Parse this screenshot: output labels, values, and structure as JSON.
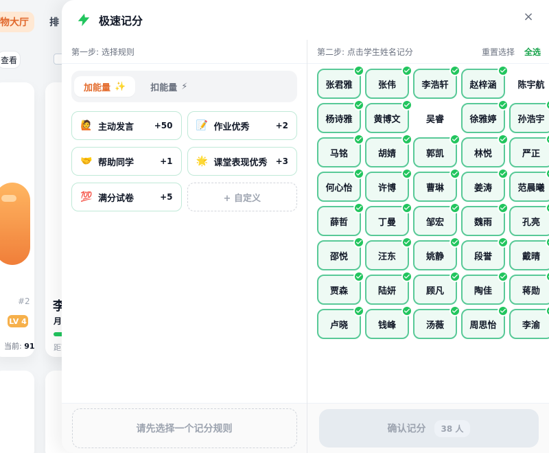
{
  "background": {
    "top_tab_1": "物大厅",
    "top_tab_2": "排",
    "view_button": "查看",
    "rank_label": "#2",
    "level_badge": "LV 4",
    "current_label": "当前:",
    "current_value": "91",
    "student_name_partial": "李",
    "month_label_partial": "月",
    "distance_label_partial": "距下"
  },
  "modal": {
    "title": "极速记分",
    "close_symbol": "×",
    "step1_label": "第一步: 选择规则",
    "step2_label": "第二步: 点击学生姓名记分",
    "reset_label": "重置选择",
    "select_all_label": "全选",
    "tabs": [
      {
        "label": "加能量",
        "icon": "sparkles"
      },
      {
        "label": "扣能量",
        "icon": "lightning"
      }
    ],
    "rules": [
      {
        "emoji": "🙋",
        "label": "主动发言",
        "points": "+50"
      },
      {
        "emoji": "📝",
        "label": "作业优秀",
        "points": "+2"
      },
      {
        "emoji": "🤝",
        "label": "帮助同学",
        "points": "+1"
      },
      {
        "emoji": "🌟",
        "label": "课堂表现优秀",
        "points": "+3"
      },
      {
        "emoji": "💯",
        "label": "满分试卷",
        "points": "+5"
      }
    ],
    "custom_rule_label": "+ 自定义",
    "left_bottom_hint": "请先选择一个记分规则",
    "students": [
      {
        "name": "张君雅",
        "selected": true
      },
      {
        "name": "张伟",
        "selected": true
      },
      {
        "name": "李浩轩",
        "selected": true
      },
      {
        "name": "赵梓涵",
        "selected": true
      },
      {
        "name": "陈宇航",
        "selected": false
      },
      {
        "name": "杨诗雅",
        "selected": true
      },
      {
        "name": "黄博文",
        "selected": true
      },
      {
        "name": "吴睿",
        "selected": false
      },
      {
        "name": "徐雅婷",
        "selected": true
      },
      {
        "name": "孙浩宇",
        "selected": true
      },
      {
        "name": "马铭",
        "selected": true
      },
      {
        "name": "胡婧",
        "selected": true
      },
      {
        "name": "郭凯",
        "selected": true
      },
      {
        "name": "林悦",
        "selected": true
      },
      {
        "name": "严正",
        "selected": true
      },
      {
        "name": "何心怡",
        "selected": true
      },
      {
        "name": "许博",
        "selected": true
      },
      {
        "name": "曹琳",
        "selected": true
      },
      {
        "name": "姜涛",
        "selected": true
      },
      {
        "name": "范晨曦",
        "selected": true
      },
      {
        "name": "薛哲",
        "selected": true
      },
      {
        "name": "丁曼",
        "selected": true
      },
      {
        "name": "邹宏",
        "selected": true
      },
      {
        "name": "魏雨",
        "selected": true
      },
      {
        "name": "孔亮",
        "selected": true
      },
      {
        "name": "邵悦",
        "selected": true
      },
      {
        "name": "汪东",
        "selected": true
      },
      {
        "name": "姚静",
        "selected": true
      },
      {
        "name": "段誉",
        "selected": true
      },
      {
        "name": "戴晴",
        "selected": true
      },
      {
        "name": "贾森",
        "selected": true
      },
      {
        "name": "陆妍",
        "selected": true
      },
      {
        "name": "顾凡",
        "selected": true
      },
      {
        "name": "陶佳",
        "selected": true
      },
      {
        "name": "蒋勋",
        "selected": true
      },
      {
        "name": "卢晓",
        "selected": true
      },
      {
        "name": "钱峰",
        "selected": true
      },
      {
        "name": "汤薇",
        "selected": true
      },
      {
        "name": "周思怡",
        "selected": true
      },
      {
        "name": "李渝",
        "selected": true
      }
    ],
    "confirm_label": "确认记分",
    "confirm_count": "38 人"
  }
}
